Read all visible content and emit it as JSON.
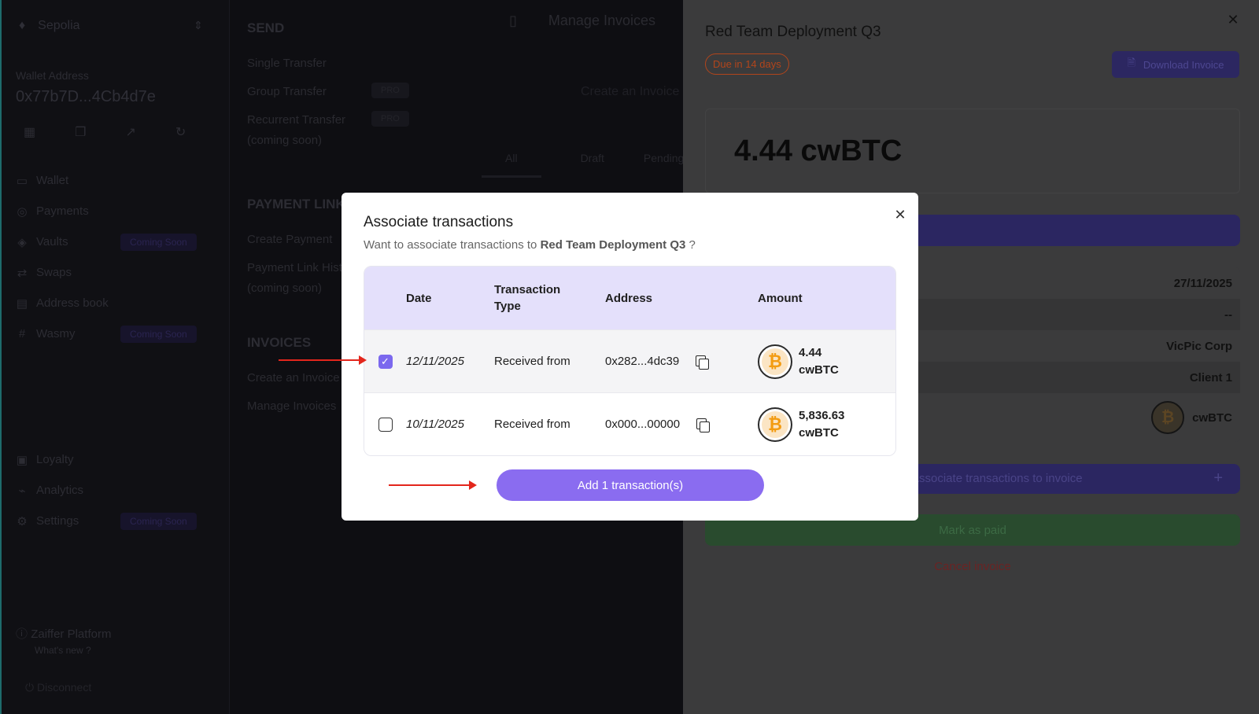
{
  "sidebar": {
    "network": "Sepolia",
    "wallet_label": "Wallet Address",
    "wallet_address": "0x77b7D...4Cb4d7e",
    "nav": [
      {
        "label": "Wallet",
        "icon": "wallet-icon"
      },
      {
        "label": "Payments",
        "icon": "payments-icon"
      },
      {
        "label": "Vaults",
        "icon": "vaults-icon",
        "badge": "Coming Soon"
      },
      {
        "label": "Swaps",
        "icon": "swaps-icon"
      },
      {
        "label": "Address book",
        "icon": "address-book-icon"
      },
      {
        "label": "Wasmy",
        "icon": "wasmy-icon",
        "badge": "Coming Soon"
      }
    ],
    "nav_bottom": [
      {
        "label": "Loyalty",
        "icon": "loyalty-icon"
      },
      {
        "label": "Analytics",
        "icon": "analytics-icon"
      },
      {
        "label": "Settings",
        "icon": "settings-icon",
        "badge": "Coming Soon"
      }
    ],
    "platform_title": "Zaiffer Platform",
    "platform_sub": "What's new ?",
    "footer": "Disconnect"
  },
  "send_menu": {
    "heading": "SEND",
    "items": [
      {
        "label": "Single Transfer"
      },
      {
        "label": "Group Transfer",
        "badge": "PRO"
      },
      {
        "label": "Recurrent Transfer",
        "badge": "PRO"
      },
      {
        "label": "(coming soon)"
      }
    ],
    "heading2": "PAYMENT LINK",
    "items2": [
      {
        "label": "Create Payment"
      },
      {
        "label": "Payment Link History"
      },
      {
        "label": "(coming soon)"
      }
    ],
    "heading3": "INVOICES",
    "items3": [
      {
        "label": "Create an Invoice"
      },
      {
        "label": "Manage Invoices"
      }
    ]
  },
  "manage": {
    "title": "Manage Invoices",
    "create": "Create an Invoice",
    "tabs": [
      "All",
      "Draft",
      "Pending"
    ]
  },
  "invoice_panel": {
    "title": "Red Team Deployment Q3",
    "due_badge": "Due in 14 days",
    "download_label": "Download Invoice",
    "amount": "4.44 cwBTC",
    "details": [
      "27/11/2025",
      "--",
      "VicPic Corp",
      "Client 1"
    ],
    "token_label": "cwBTC",
    "add_label": "Associate transactions to invoice",
    "mark_paid": "Mark as paid",
    "cancel": "Cancel invoice"
  },
  "modal": {
    "title": "Associate transactions",
    "subtitle_prefix": "Want to associate transactions to",
    "subtitle_invoice": "Red Team Deployment Q3",
    "subtitle_suffix": "?",
    "columns": [
      "Date",
      "Transaction Type",
      "Address",
      "Amount"
    ],
    "rows": [
      {
        "checked": true,
        "date": "12/11/2025",
        "type": "Received from",
        "address": "0x282...4dc39",
        "amount": "4.44",
        "token": "cwBTC"
      },
      {
        "checked": false,
        "date": "10/11/2025",
        "type": "Received from",
        "address": "0x000...00000",
        "amount": "5,836.63",
        "token": "cwBTC"
      }
    ],
    "add_button": "Add 1 transaction(s)"
  },
  "colors": {
    "accent": "#8a6cf0",
    "header_bg": "#e4e0fb",
    "arrow": "#e3261c",
    "bitcoin": "#f39c12"
  }
}
